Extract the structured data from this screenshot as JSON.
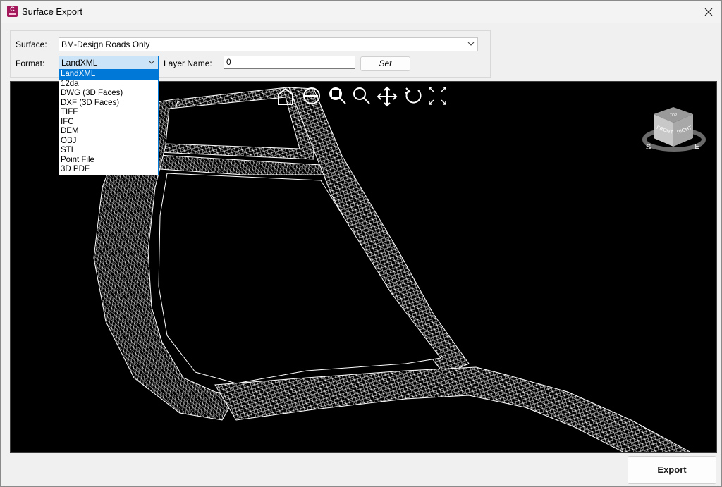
{
  "window": {
    "title": "Surface Export",
    "app_icon_letter": "C",
    "accent_color": "#a3195b"
  },
  "form": {
    "surface_label": "Surface:",
    "surface_value": "BM-Design Roads Only",
    "format_label": "Format:",
    "format_value": "LandXML",
    "layer_label": "Layer Name:",
    "layer_value": "0",
    "set_label": "Set"
  },
  "format_options": [
    "LandXML",
    "12da",
    "DWG (3D Faces)",
    "DXF (3D Faces)",
    "TIFF",
    "IFC",
    "DEM",
    "OBJ",
    "STL",
    "Point File",
    "3D PDF"
  ],
  "format_selected_index": 0,
  "viewport": {
    "toolbar_icons": [
      "home-icon",
      "orbit-icon",
      "zoom-window-icon",
      "zoom-icon",
      "pan-icon",
      "rotate-icon",
      "extents-icon"
    ],
    "viewcube": {
      "front_label": "FRONT",
      "right_label": "RIGHT",
      "top_label": "TOP",
      "compass_s": "S",
      "compass_e": "E"
    }
  },
  "footer": {
    "export_label": "Export"
  }
}
